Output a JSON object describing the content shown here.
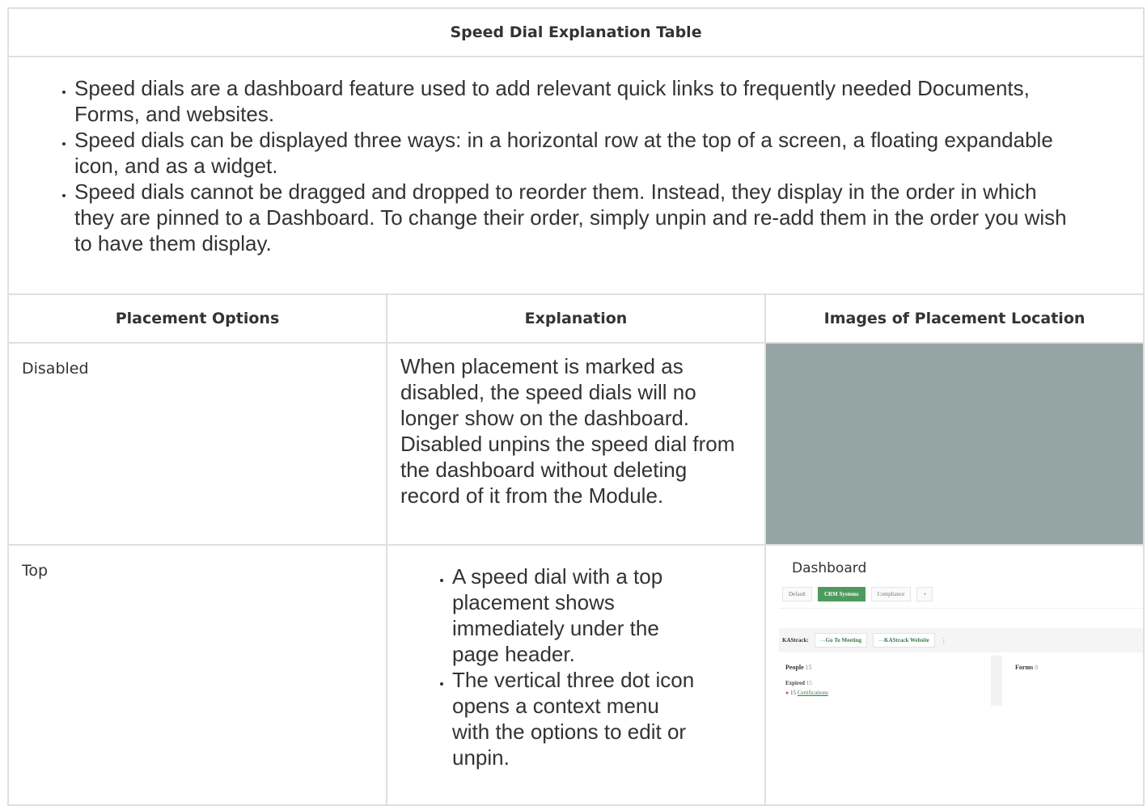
{
  "title": "Speed Dial Explanation Table",
  "intro_bullets": [
    "Speed dials are a dashboard feature used to add relevant quick links to frequently needed Documents, Forms, and websites.",
    "Speed dials can be displayed three ways: in a horizontal row at the top of a screen, a floating expandable icon, and as a widget.",
    "Speed dials cannot be dragged and dropped to reorder them. Instead, they display in the order in which they are pinned to a Dashboard. To change their order, simply unpin and re-add them in the order you wish to have them display."
  ],
  "columns": [
    "Placement Options",
    "Explanation",
    "Images of Placement Location"
  ],
  "rows": [
    {
      "option": "Disabled",
      "explanation": "When placement is marked as disabled, the speed dials will no longer show on the dashboard. Disabled unpins the speed dial from the dashboard without deleting record of it from the Module.",
      "image_color": "#95a5a3"
    },
    {
      "option": "Top",
      "explanation_bullets": [
        "A speed dial with a top placement shows immediately under the page header.",
        "The vertical three dot icon opens a context menu with the options to edit or unpin."
      ],
      "screenshot": {
        "title": "Dashboard",
        "tabs": [
          "Default",
          "CRM Systems",
          "Compliance",
          "+"
        ],
        "active_tab": "CRM Systems",
        "bar_label": "KAStrack:",
        "chips": [
          "Go To Meeting",
          "KAStrack Website"
        ],
        "people_label": "People",
        "people_count": "15",
        "expired_label": "Expired",
        "expired_count": "15",
        "cert_count": "15",
        "cert_link": "Certifications",
        "forms_label": "Forms",
        "forms_count": "0",
        "dots_icon": "vertical-dots-icon",
        "accent": "#4e9a5e"
      }
    }
  ]
}
